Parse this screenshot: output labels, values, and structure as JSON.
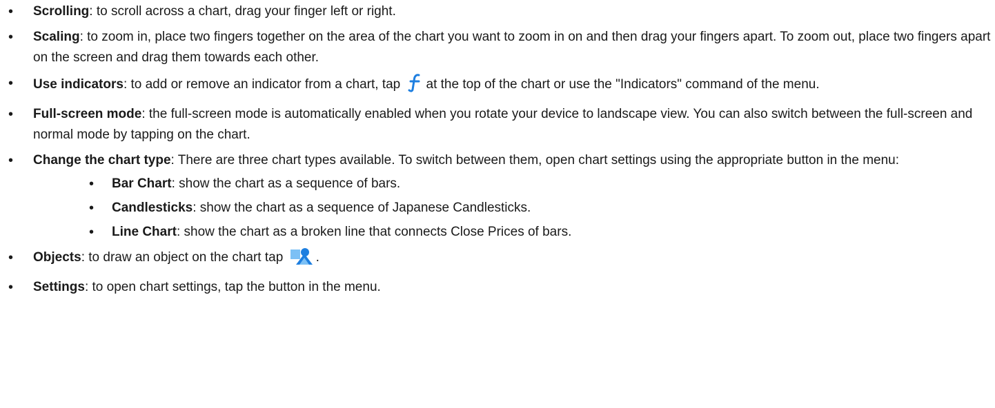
{
  "items": [
    {
      "term": "Scrolling",
      "text": ": to scroll across a chart, drag your finger left or right."
    },
    {
      "term": "Scaling",
      "text": ": to zoom in, place two fingers together on the area of the chart you want to zoom in on and then drag your fingers apart. To zoom out, place two fingers apart on the screen and drag them towards each other."
    },
    {
      "term": "Use indicators",
      "text_before": ": to add or remove an indicator from a chart, tap",
      "icon": "function-f-icon",
      "text_after": "at the top of the chart or use the \"Indicators\" command of the menu."
    },
    {
      "term": "Full-screen mode",
      "text": ": the full-screen mode is automatically enabled when you rotate your device to landscape view. You can also switch between the full-screen and normal mode by tapping on the chart."
    },
    {
      "term": "Change the chart type",
      "text": ": There are three chart types available. To switch between them, open chart settings using the appropriate button in the menu:",
      "subitems": [
        {
          "term": "Bar Chart",
          "text": ": show the chart as a sequence of bars."
        },
        {
          "term": "Candlesticks",
          "text": ": show the chart as a sequence of Japanese Candlesticks."
        },
        {
          "term": "Line Chart",
          "text": ": show the chart as a broken line that connects Close Prices of bars."
        }
      ]
    },
    {
      "term": "Objects",
      "text_before": ": to draw an object on the chart tap",
      "icon": "objects-shapes-icon",
      "text_after": "."
    },
    {
      "term": "Settings",
      "text": ": to open chart settings, tap the button in the menu."
    }
  ],
  "colors": {
    "text": "#1a1a1a",
    "icon_blue": "#1e7fe0",
    "icon_light_blue": "#7cc0f5"
  }
}
